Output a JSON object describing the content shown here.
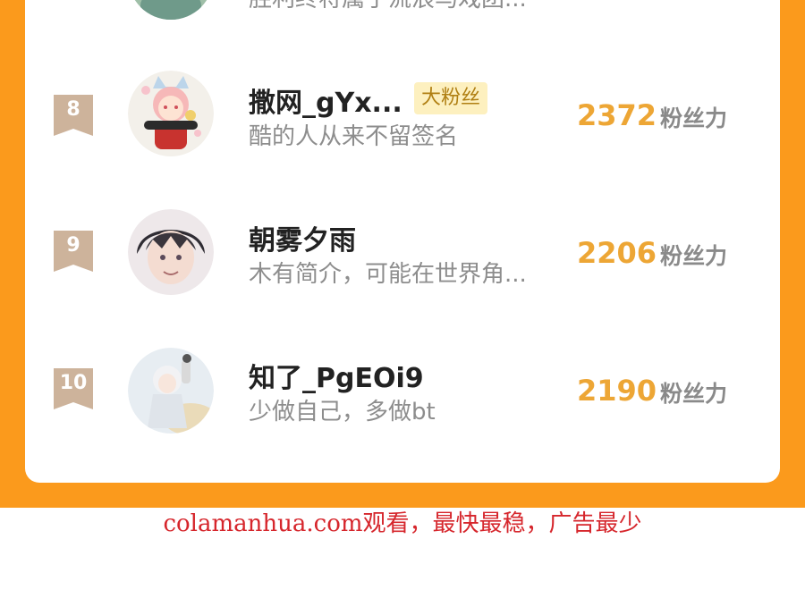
{
  "previous_row": {
    "signature": "胜利终将属于流浪马戏团..."
  },
  "leaderboard": [
    {
      "rank": "8",
      "name": "撒网_gYx...",
      "badge": "大粉丝",
      "signature": "酷的人从来不留签名",
      "score": "2372",
      "unit": "粉丝力"
    },
    {
      "rank": "9",
      "name": "朝雾夕雨",
      "badge": "",
      "signature": "木有简介，可能在世界角...",
      "score": "2206",
      "unit": "粉丝力"
    },
    {
      "rank": "10",
      "name": "知了_PgEOi9",
      "badge": "",
      "signature": "少做自己，多做bt",
      "score": "2190",
      "unit": "粉丝力"
    }
  ],
  "watermark": "colamanhua.com观看，最快最稳，广告最少",
  "colors": {
    "background_orange": "#fb9a1c",
    "score_gold": "#eda635",
    "rank_badge": "#cdb39b",
    "badge_bg": "#fdf0bf",
    "watermark_red": "#d6262c"
  }
}
